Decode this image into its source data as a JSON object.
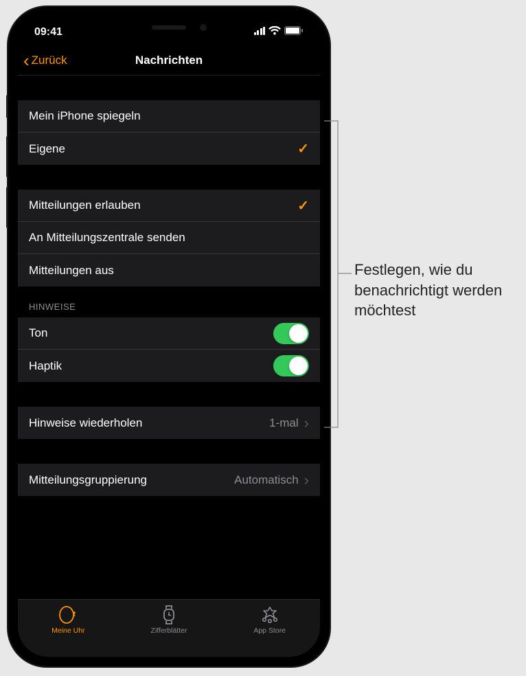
{
  "status": {
    "time": "09:41"
  },
  "nav": {
    "back": "Zurück",
    "title": "Nachrichten"
  },
  "group1": {
    "items": [
      {
        "label": "Mein iPhone spiegeln",
        "checked": false
      },
      {
        "label": "Eigene",
        "checked": true
      }
    ]
  },
  "group2": {
    "items": [
      {
        "label": "Mitteilungen erlauben",
        "checked": true
      },
      {
        "label": "An Mitteilungszentrale senden",
        "checked": false
      },
      {
        "label": "Mitteilungen aus",
        "checked": false
      }
    ]
  },
  "hints": {
    "header": "HINWEISE",
    "items": [
      {
        "label": "Ton",
        "on": true
      },
      {
        "label": "Haptik",
        "on": true
      }
    ]
  },
  "repeat": {
    "label": "Hinweise wiederholen",
    "value": "1-mal"
  },
  "grouping": {
    "label": "Mitteilungsgruppierung",
    "value": "Automatisch"
  },
  "tabs": [
    {
      "label": "Meine Uhr",
      "active": true
    },
    {
      "label": "Zifferblätter",
      "active": false
    },
    {
      "label": "App Store",
      "active": false
    }
  ],
  "callout": "Festlegen, wie du benachrichtigt werden möchtest"
}
